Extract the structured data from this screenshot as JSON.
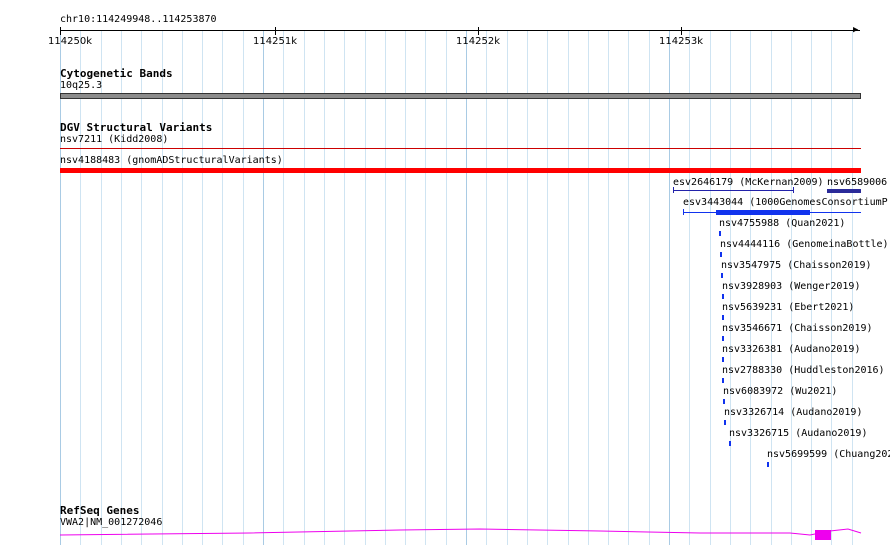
{
  "ruler": {
    "location": "chr10:114249948..114253870",
    "ticks": [
      "114250k",
      "114251k",
      "114252k",
      "114253k"
    ]
  },
  "tracks": {
    "cytoband": {
      "title": "Cytogenetic Bands",
      "band_label": "10q25.3",
      "band_color": "#8c8c8c"
    },
    "dgv": {
      "title": "DGV Structural Variants",
      "features": [
        {
          "label": "nsv7211 (Kidd2008)",
          "color": "#cc0000"
        },
        {
          "label": "nsv4188483 (gnomADStructuralVariants)",
          "color": "#ff0000"
        },
        {
          "label": "esv2646179 (McKernan2009)",
          "color": "#2222aa"
        },
        {
          "label": "nsv6589006",
          "color": "#2a2a99"
        },
        {
          "label": "esv3443044 (1000GenomesConsortiumP",
          "color": "#1133ee"
        },
        {
          "label": "nsv4755988 (Quan2021)",
          "color": "#1133ee"
        },
        {
          "label": "nsv4444116 (GenomeinaBottle)",
          "color": "#1133ee"
        },
        {
          "label": "nsv3547975 (Chaisson2019)",
          "color": "#1133ee"
        },
        {
          "label": "nsv3928903 (Wenger2019)",
          "color": "#1133ee"
        },
        {
          "label": "nsv5639231 (Ebert2021)",
          "color": "#1133ee"
        },
        {
          "label": "nsv3546671 (Chaisson2019)",
          "color": "#1133ee"
        },
        {
          "label": "nsv3326381 (Audano2019)",
          "color": "#1133ee"
        },
        {
          "label": "nsv2788330 (Huddleston2016)",
          "color": "#1133ee"
        },
        {
          "label": "nsv6083972 (Wu2021)",
          "color": "#1133ee"
        },
        {
          "label": "nsv3326714 (Audano2019)",
          "color": "#1133ee"
        },
        {
          "label": "nsv3326715 (Audano2019)",
          "color": "#1133ee"
        },
        {
          "label": "nsv5699599 (Chuang202",
          "color": "#1133ee"
        }
      ]
    },
    "refseq": {
      "title": "RefSeq Genes",
      "gene_label": "VWA2|NM_001272046",
      "color": "#ee00ee"
    }
  }
}
